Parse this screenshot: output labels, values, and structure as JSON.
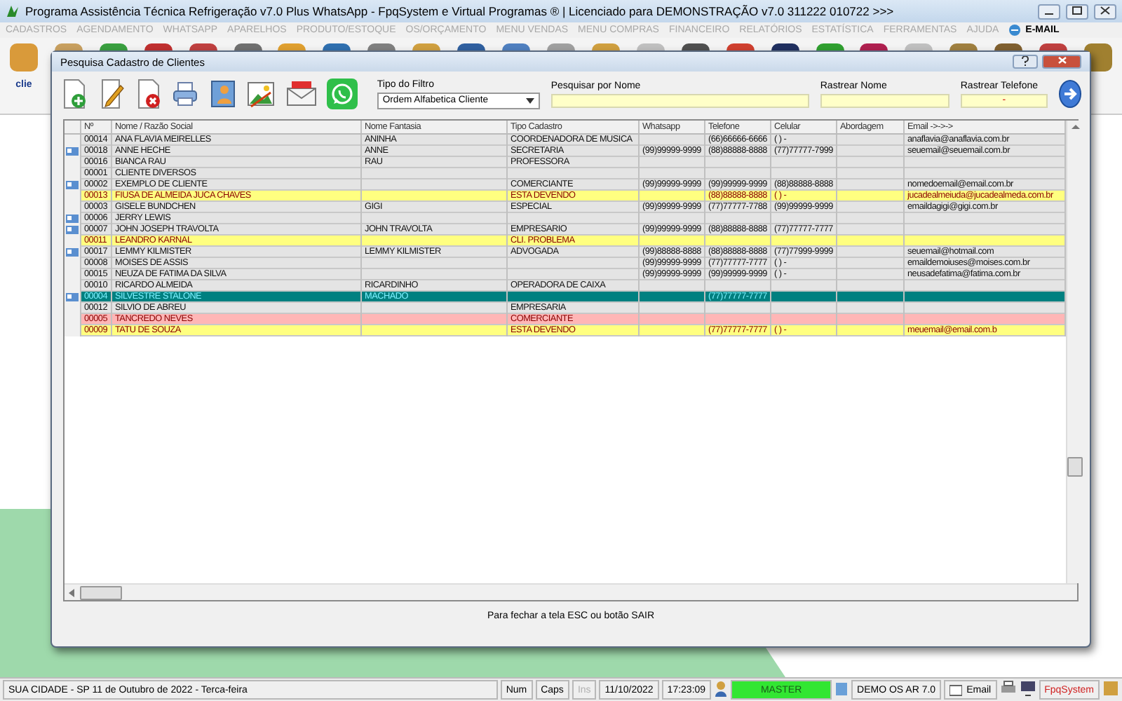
{
  "window": {
    "title": "Programa Assistência Técnica Refrigeração v7.0 Plus WhatsApp - FpqSystem e Virtual Programas ® | Licenciado para  DEMONSTRAÇÃO v7.0 311222 010722 >>>"
  },
  "menu": [
    {
      "label": "CADASTROS",
      "disabled": true
    },
    {
      "label": "AGENDAMENTO",
      "disabled": true
    },
    {
      "label": "WHATSAPP",
      "disabled": true
    },
    {
      "label": "APARELHOS",
      "disabled": true
    },
    {
      "label": "PRODUTO/ESTOQUE",
      "disabled": true
    },
    {
      "label": "OS/ORÇAMENTO",
      "disabled": true
    },
    {
      "label": "MENU VENDAS",
      "disabled": true
    },
    {
      "label": "MENU COMPRAS",
      "disabled": true
    },
    {
      "label": "FINANCEIRO",
      "disabled": true
    },
    {
      "label": "RELATÓRIOS",
      "disabled": true
    },
    {
      "label": "ESTATÍSTICA",
      "disabled": true
    },
    {
      "label": "FERRAMENTAS",
      "disabled": true
    },
    {
      "label": "AJUDA",
      "disabled": true
    },
    {
      "label": "E-MAIL",
      "disabled": false
    }
  ],
  "main_toolbar": {
    "first_label": "clie"
  },
  "dialog": {
    "title": "Pesquisa Cadastro de Clientes",
    "filter": {
      "label": "Tipo do Filtro",
      "value": "Ordem Alfabetica Cliente"
    },
    "search_name": {
      "label": "Pesquisar por Nome"
    },
    "track_name": {
      "label": "Rastrear Nome"
    },
    "track_phone": {
      "label": "Rastrear Telefone",
      "value": "-"
    },
    "footer": "Para fechar a tela ESC ou botão SAIR"
  },
  "table": {
    "columns": [
      "Nº",
      "Nome / Razão Social",
      "Nome Fantasia",
      "Tipo Cadastro",
      "Whatsapp",
      "Telefone",
      "Celular",
      "Abordagem",
      "Email ->->->"
    ],
    "rows": [
      {
        "number": "00014",
        "name": "ANA FLAVIA MEIRELLES",
        "fantasy": "ANINHA",
        "type": "COORDENADORA DE MUSICA",
        "phone": "(66)66666-6666",
        "mobile": "(  )      -",
        "email": "anaflavia@anaflavia.com.br",
        "card": false,
        "selected": false,
        "color": "#e4e4e4"
      },
      {
        "number": "00018",
        "name": "ANNE HECHE",
        "fantasy": "ANNE",
        "type": "SECRETARIA",
        "whatsapp": "(99)99999-9999",
        "phone": "(88)88888-8888",
        "mobile": "(77)77777-7999",
        "email": "seuemail@seuemail.com.br",
        "card": true,
        "selected": false,
        "color": "#e4e4e4"
      },
      {
        "number": "00016",
        "name": "BIANCA RAU",
        "fantasy": "RAU",
        "type": "PROFESSORA",
        "card": false,
        "selected": false,
        "color": "#e4e4e4"
      },
      {
        "number": "00001",
        "name": "CLIENTE DIVERSOS",
        "card": false,
        "selected": false,
        "color": "#e4e4e4"
      },
      {
        "number": "00002",
        "name": "EXEMPLO DE CLIENTE",
        "type": "COMERCIANTE",
        "whatsapp": "(99)99999-9999",
        "phone": "(99)99999-9999",
        "mobile": "(88)88888-8888",
        "email": "nomedoemail@email.com.br",
        "card": true,
        "selected": false,
        "color": "#e4e4e4"
      },
      {
        "number": "00013",
        "name": "FIUSA DE ALMEIDA JUCA CHAVES",
        "type": "ESTA DEVENDO",
        "phone": "(88)88888-8888",
        "mobile": "(  )      -",
        "email": "jucadealmeiuda@jucadealmeda.com.br",
        "card": false,
        "selected": false,
        "color": "#ffff80"
      },
      {
        "number": "00003",
        "name": "GISELE BUNDCHEN",
        "fantasy": "GIGI",
        "type": "ESPECIAL",
        "whatsapp": "(99)99999-9999",
        "phone": "(77)77777-7788",
        "mobile": "(99)99999-9999",
        "email": "emaildagigi@gigi.com.br",
        "card": false,
        "selected": false,
        "color": "#e4e4e4"
      },
      {
        "number": "00006",
        "name": "JERRY LEWIS",
        "card": true,
        "selected": false,
        "color": "#e4e4e4"
      },
      {
        "number": "00007",
        "name": "JOHN JOSEPH TRAVOLTA",
        "fantasy": "JOHN TRAVOLTA",
        "type": "EMPRESARIO",
        "whatsapp": "(99)99999-9999",
        "phone": "(88)88888-8888",
        "mobile": "(77)77777-7777",
        "card": true,
        "selected": false,
        "color": "#e4e4e4"
      },
      {
        "number": "00011",
        "name": "LEANDRO KARNAL",
        "type": "CLI. PROBLEMA",
        "card": false,
        "selected": false,
        "color": "#ffff80"
      },
      {
        "number": "00017",
        "name": "LEMMY KILMISTER",
        "fantasy": "LEMMY KILMISTER",
        "type": "ADVOGADA",
        "whatsapp": "(99)88888-8888",
        "phone": "(88)88888-8888",
        "mobile": "(77)77999-9999",
        "email": "seuemail@hotmail.com",
        "card": true,
        "selected": false,
        "color": "#e4e4e4"
      },
      {
        "number": "00008",
        "name": "MOISES DE ASSIS",
        "whatsapp": "(99)99999-9999",
        "phone": "(77)77777-7777",
        "mobile": "(  )      -",
        "email": "emaildemoiuses@moises.com.br",
        "card": false,
        "selected": false,
        "color": "#e4e4e4"
      },
      {
        "number": "00015",
        "name": "NEUZA DE FATIMA DA SILVA",
        "whatsapp": "(99)99999-9999",
        "phone": "(99)99999-9999",
        "mobile": "(  )      -",
        "email": "neusadefatima@fatima.com.br",
        "card": false,
        "selected": false,
        "color": "#e4e4e4"
      },
      {
        "number": "00010",
        "name": "RICARDO ALMEIDA",
        "fantasy": "RICARDINHO",
        "type": "OPERADORA DE CAIXA",
        "card": false,
        "selected": false,
        "color": "#e4e4e4"
      },
      {
        "number": "00004",
        "name": "SILVESTRE STALONE",
        "fantasy": "MACHADO",
        "phone": "(77)77777-7777",
        "card": true,
        "selected": true
      },
      {
        "number": "00012",
        "name": "SILVIO DE ABREU",
        "type": "EMPRESARIA",
        "card": false,
        "selected": false,
        "color": "#e4e4e4"
      },
      {
        "number": "00005",
        "name": "TANCREDO NEVES",
        "type": "COMERCIANTE",
        "card": false,
        "selected": false,
        "color": "#ffb6b6"
      },
      {
        "number": "00009",
        "name": "TATU DE SOUZA",
        "type": "ESTA DEVENDO",
        "phone": "(77)77777-7777",
        "mobile": "(  )      -",
        "email": "meuemail@email.com.b",
        "card": false,
        "selected": false,
        "color": "#ffff80"
      }
    ]
  },
  "status_bar": {
    "location": "SUA CIDADE - SP 11 de Outubro de 2022 - Terca-feira",
    "keys": [
      {
        "label": "Num",
        "disabled": false
      },
      {
        "label": "Caps",
        "disabled": false
      },
      {
        "label": "Ins",
        "disabled": true
      }
    ],
    "date": "11/10/2022",
    "time": "17:23:09",
    "user": "MASTER",
    "server": "DEMO OS AR 7.0",
    "email": "Email",
    "brand": "FpqSystem"
  }
}
